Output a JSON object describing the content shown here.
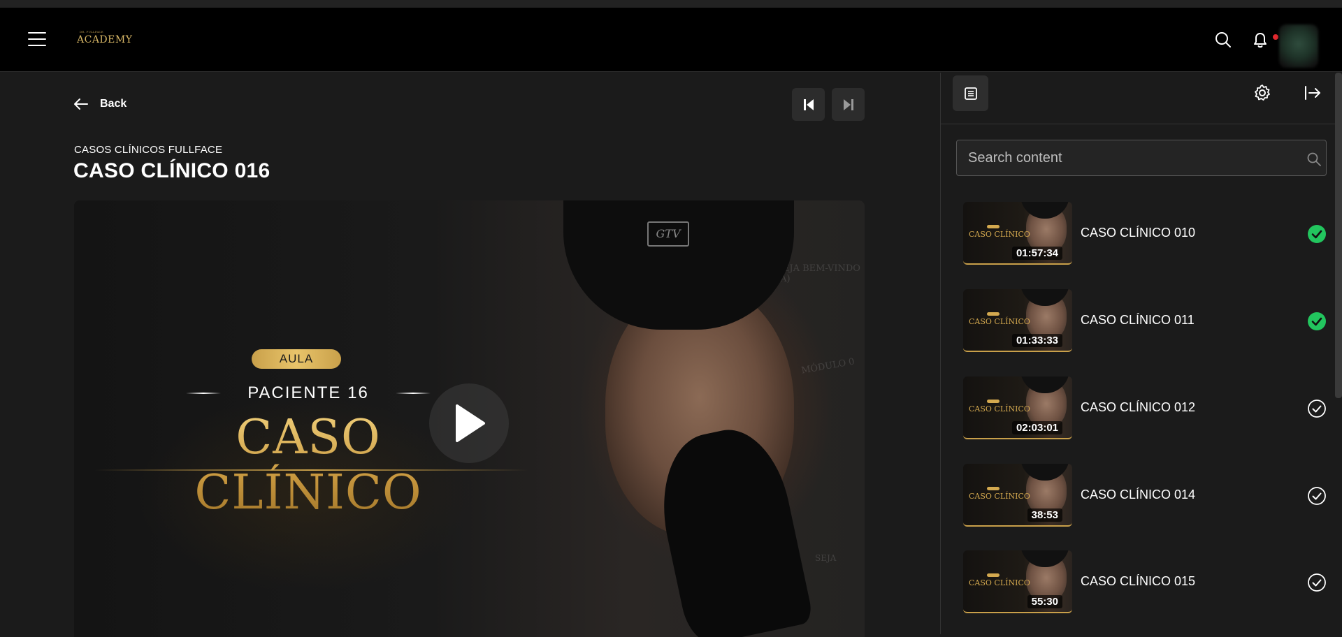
{
  "header": {
    "logo_text": "ACADEMY",
    "logo_subtext": "DR. FULLFACE",
    "icons": [
      "menu-icon",
      "search-icon",
      "bell-icon"
    ],
    "notification_dot_color": "#e0282e"
  },
  "player": {
    "back_label": "Back",
    "breadcrumb": "CASOS CLÍNICOS FULLFACE",
    "title": "CASO CLÍNICO 016",
    "video": {
      "badge": "AULA",
      "subtitle": "PACIENTE 16",
      "headline": "CASO CLÍNICO",
      "hat_logo": "GTV",
      "bg_text_1": "SEJA BEM-VINDO (A)",
      "bg_text_2": "MÓDULO 0",
      "bg_text_3": "SEJA"
    }
  },
  "sidebar": {
    "search_placeholder": "Search content",
    "items": [
      {
        "label": "CASO CLÍNICO 010",
        "duration": "01:57:34",
        "completed": true
      },
      {
        "label": "CASO CLÍNICO 011",
        "duration": "01:33:33",
        "completed": true
      },
      {
        "label": "CASO CLÍNICO 012",
        "duration": "02:03:01",
        "completed": false
      },
      {
        "label": "CASO CLÍNICO 014",
        "duration": "38:53",
        "completed": false
      },
      {
        "label": "CASO CLÍNICO 015",
        "duration": "55:30",
        "completed": false
      }
    ],
    "thumb_caption": "CASO CLÍNICO"
  },
  "colors": {
    "accent_gold": "#c9a04a",
    "completed_green": "#22c55e",
    "background": "#1b1b1b",
    "header": "#000000"
  }
}
